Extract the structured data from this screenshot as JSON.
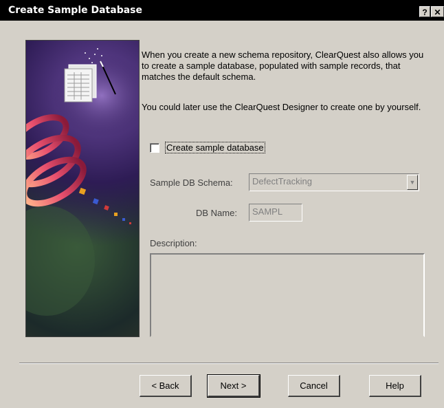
{
  "window": {
    "title": "Create Sample Database",
    "help_glyph": "?",
    "close_glyph": "✕"
  },
  "intro_text": "When you create a new schema repository, ClearQuest also allows you to create a sample database, populated with sample records, that matches the default schema.",
  "later_text": "You could later use the ClearQuest Designer to create one by yourself.",
  "checkbox": {
    "label": "Create sample database",
    "checked": false
  },
  "schema": {
    "label": "Sample DB Schema:",
    "value": "DefectTracking",
    "dropdown_glyph": "▼"
  },
  "db_name": {
    "label": "DB Name:",
    "value": "SAMPL"
  },
  "description": {
    "label": "Description:",
    "value": ""
  },
  "buttons": {
    "back": "< Back",
    "next": "Next >",
    "cancel": "Cancel",
    "help": "Help"
  }
}
